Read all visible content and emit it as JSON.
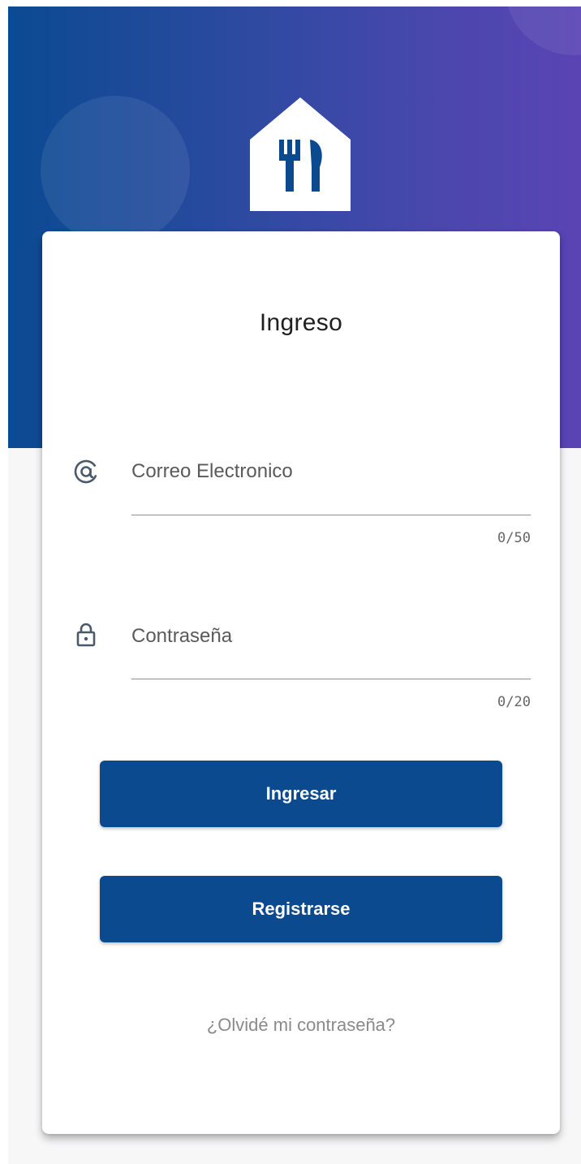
{
  "colors": {
    "brand_primary": "#0b4a8f",
    "gradient_start": "#0b4a92",
    "gradient_end": "#5a44b4",
    "card_background": "#ffffff"
  },
  "logo": {
    "icon": "restaurant-house-icon"
  },
  "login_card": {
    "title": "Ingreso",
    "email": {
      "icon": "at-sign-icon",
      "placeholder": "Correo Electronico",
      "value": "",
      "counter": "0/50"
    },
    "password": {
      "icon": "lock-icon",
      "placeholder": "Contraseña",
      "value": "",
      "counter": "0/20"
    },
    "login_button_label": "Ingresar",
    "register_button_label": "Registrarse",
    "forgot_password_label": "¿Olvidé mi contraseña?"
  }
}
